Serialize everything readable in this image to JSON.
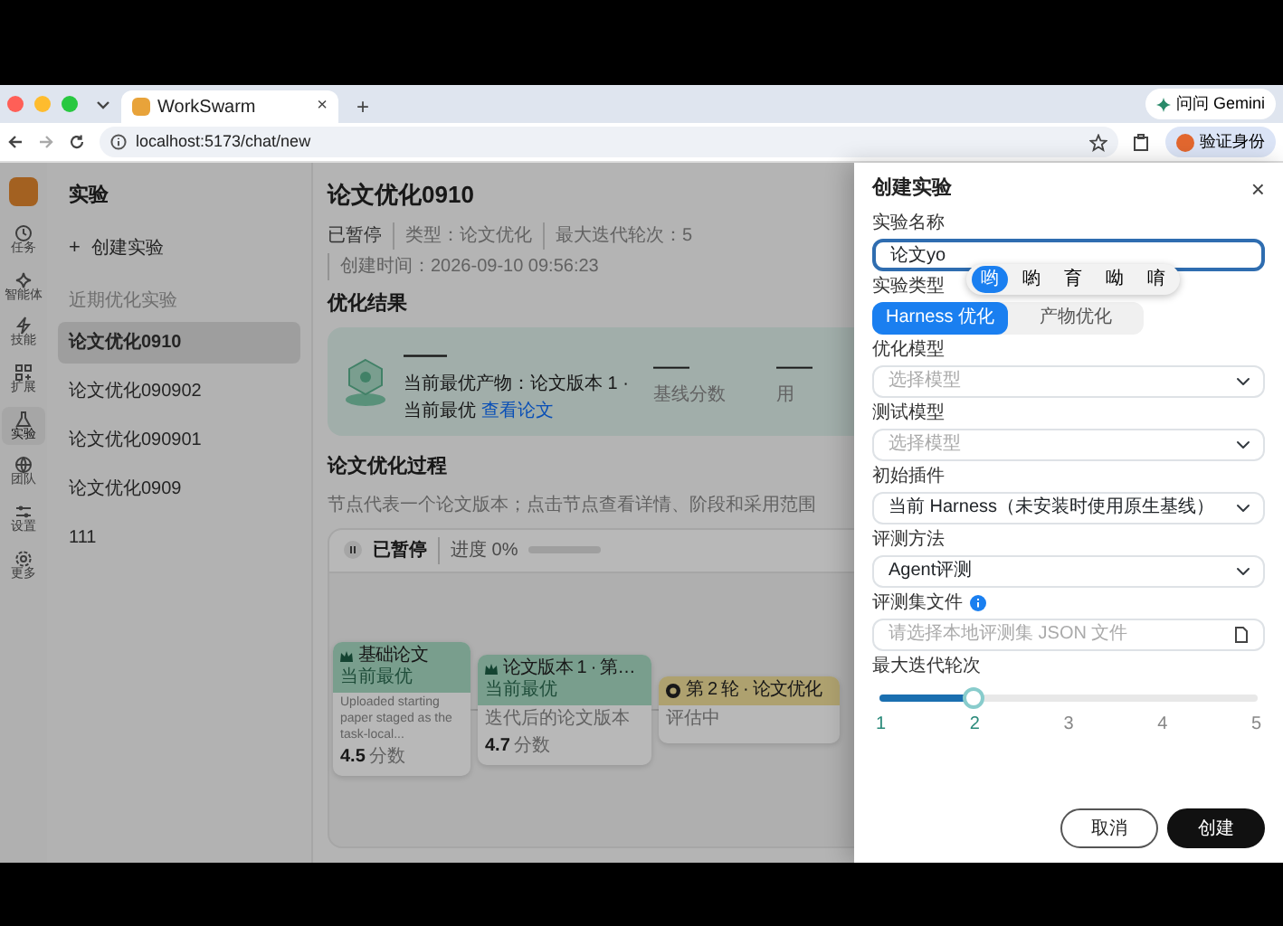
{
  "browser": {
    "tab_title": "WorkSwarm",
    "tab_close": "×",
    "new_tab": "+",
    "gemini": "问问 Gemini",
    "url": "localhost:5173/chat/new",
    "verify": "验证身份"
  },
  "rail": [
    {
      "label": "任务",
      "selected": false
    },
    {
      "label": "智能体",
      "selected": false
    },
    {
      "label": "技能",
      "selected": false
    },
    {
      "label": "扩展",
      "selected": false
    },
    {
      "label": "实验",
      "selected": true
    },
    {
      "label": "团队",
      "selected": false
    },
    {
      "label": "设置",
      "selected": false
    },
    {
      "label": "更多",
      "selected": false
    }
  ],
  "sidebar": {
    "title": "实验",
    "create_icon": "+",
    "create": "创建实验",
    "section": "近期优化实验",
    "items": [
      {
        "label": "论文优化0910",
        "selected": true
      },
      {
        "label": "论文优化090902",
        "selected": false
      },
      {
        "label": "论文优化090901",
        "selected": false
      },
      {
        "label": "论文优化0909",
        "selected": false
      },
      {
        "label": "111",
        "selected": false
      }
    ]
  },
  "main": {
    "title": "论文优化0910",
    "status": "已暂停",
    "meta": [
      "类型：论文优化",
      "最大迭代轮次：5",
      "创建时间：2026-09-10 09:56:23"
    ],
    "result_title": "优化结果",
    "result": {
      "score": "——",
      "best": "当前最优产物：论文版本 1 · 当前最优",
      "best_link": "查看论文",
      "stats": [
        {
          "value": "——",
          "label": "基线分数"
        },
        {
          "value": "——",
          "label": "用"
        }
      ]
    },
    "process_title": "论文优化过程",
    "process_hint": "节点代表一个论文版本；点击节点查看详情、阶段和采用范围",
    "run": {
      "status": "已暂停",
      "progress": "进度 0%",
      "level": 0
    },
    "nodes": [
      {
        "kind": "done",
        "title": "基础论文",
        "tag": "当前最优",
        "body": "Uploaded starting paper staged as the task-local...",
        "score": "4.5",
        "unit": "分数"
      },
      {
        "kind": "done",
        "title": "论文版本 1 · 第…",
        "tag": "当前最优",
        "body": "迭代后的论文版本",
        "score": "4.7",
        "unit": "分数"
      },
      {
        "kind": "running",
        "title": "第 2 轮 · 论文优化",
        "body": "评估中"
      }
    ]
  },
  "drawer": {
    "title": "创建实验",
    "close": "×",
    "fields": [
      {
        "kind": "text",
        "label": "实验名称",
        "value": "论文yo"
      },
      {
        "kind": "segmented",
        "label": "实验类型",
        "options": [
          {
            "label": "Harness 优化",
            "selected": true
          },
          {
            "label": "产物优化",
            "selected": false
          }
        ]
      },
      {
        "kind": "select",
        "label": "优化模型",
        "placeholder": "选择模型"
      },
      {
        "kind": "select",
        "label": "测试模型",
        "placeholder": "选择模型"
      },
      {
        "kind": "select",
        "label": "初始插件",
        "value": "当前 Harness（未安装时使用原生基线）"
      },
      {
        "kind": "select",
        "label": "评测方法",
        "value": "Agent评测"
      },
      {
        "kind": "file",
        "label": "评测集文件",
        "info": true,
        "placeholder": "请选择本地评测集 JSON 文件"
      },
      {
        "kind": "slider",
        "label": "最大迭代轮次",
        "level": 0.25,
        "ticks": [
          "1",
          "2",
          "3",
          "4",
          "5"
        ]
      }
    ],
    "ime": [
      {
        "label": "哟",
        "selected": true
      },
      {
        "label": "喲",
        "selected": false
      },
      {
        "label": "育",
        "selected": false
      },
      {
        "label": "呦",
        "selected": false
      },
      {
        "label": "唷",
        "selected": false
      }
    ],
    "buttons": [
      {
        "label": "取消",
        "kind": "secondary"
      },
      {
        "label": "创建",
        "kind": "primary"
      }
    ]
  }
}
